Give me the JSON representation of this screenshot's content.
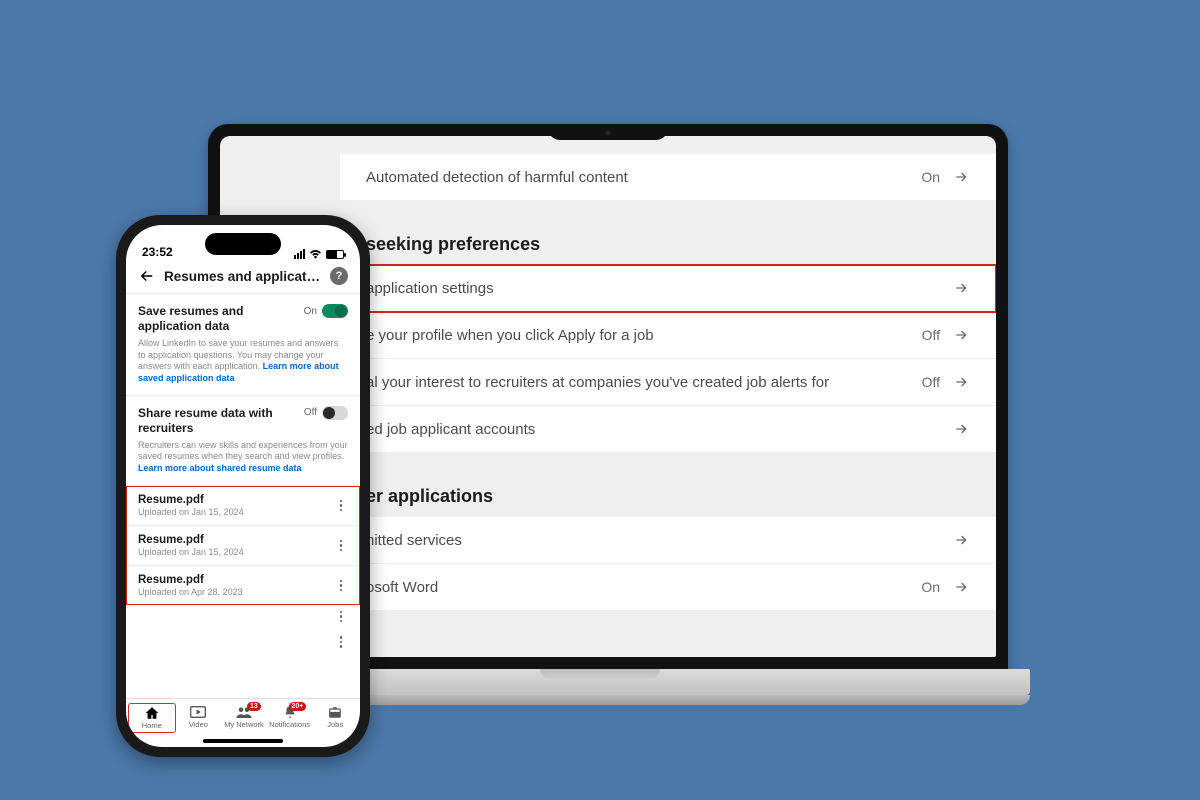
{
  "desktop": {
    "top_row": {
      "label": "Automated detection of harmful content",
      "value": "On"
    },
    "section1": {
      "title": "seeking preferences",
      "rows": [
        {
          "label": "application settings",
          "value": ""
        },
        {
          "label": "e your profile when you click Apply for a job",
          "value": "Off"
        },
        {
          "label": "al your interest to recruiters at companies you've created job alerts for",
          "value": "Off"
        },
        {
          "label": "ed job applicant accounts",
          "value": ""
        }
      ]
    },
    "section2": {
      "title": "er applications",
      "rows": [
        {
          "label": "nitted services",
          "value": ""
        },
        {
          "label": "osoft Word",
          "value": "On"
        }
      ]
    }
  },
  "phone": {
    "status": {
      "time": "23:52"
    },
    "header": {
      "title": "Resumes and application..."
    },
    "blocks": {
      "save": {
        "title": "Save resumes and application data",
        "toggle_label": "On",
        "desc": "Allow LinkedIn to save your resumes and answers to application questions. You may change your answers with each application. ",
        "link": "Learn more about saved application data"
      },
      "share": {
        "title": "Share resume data with recruiters",
        "toggle_label": "Off",
        "desc": "Recruiters can view skills and experiences from your saved resumes when they search and view profiles. ",
        "link": "Learn more about shared resume data"
      }
    },
    "files": [
      {
        "name": "Resume.pdf",
        "date": "Uploaded on Jan 15, 2024"
      },
      {
        "name": "Resume.pdf",
        "date": "Uploaded on Jan 15, 2024"
      },
      {
        "name": "Resume.pdf",
        "date": "Uploaded on Apr 28, 2023"
      }
    ],
    "tabs": {
      "home": "Home",
      "video": "Video",
      "network": "My Network",
      "notifications": "Notifications",
      "jobs": "Jobs",
      "badge_network": "13",
      "badge_notifications": "20+"
    }
  }
}
